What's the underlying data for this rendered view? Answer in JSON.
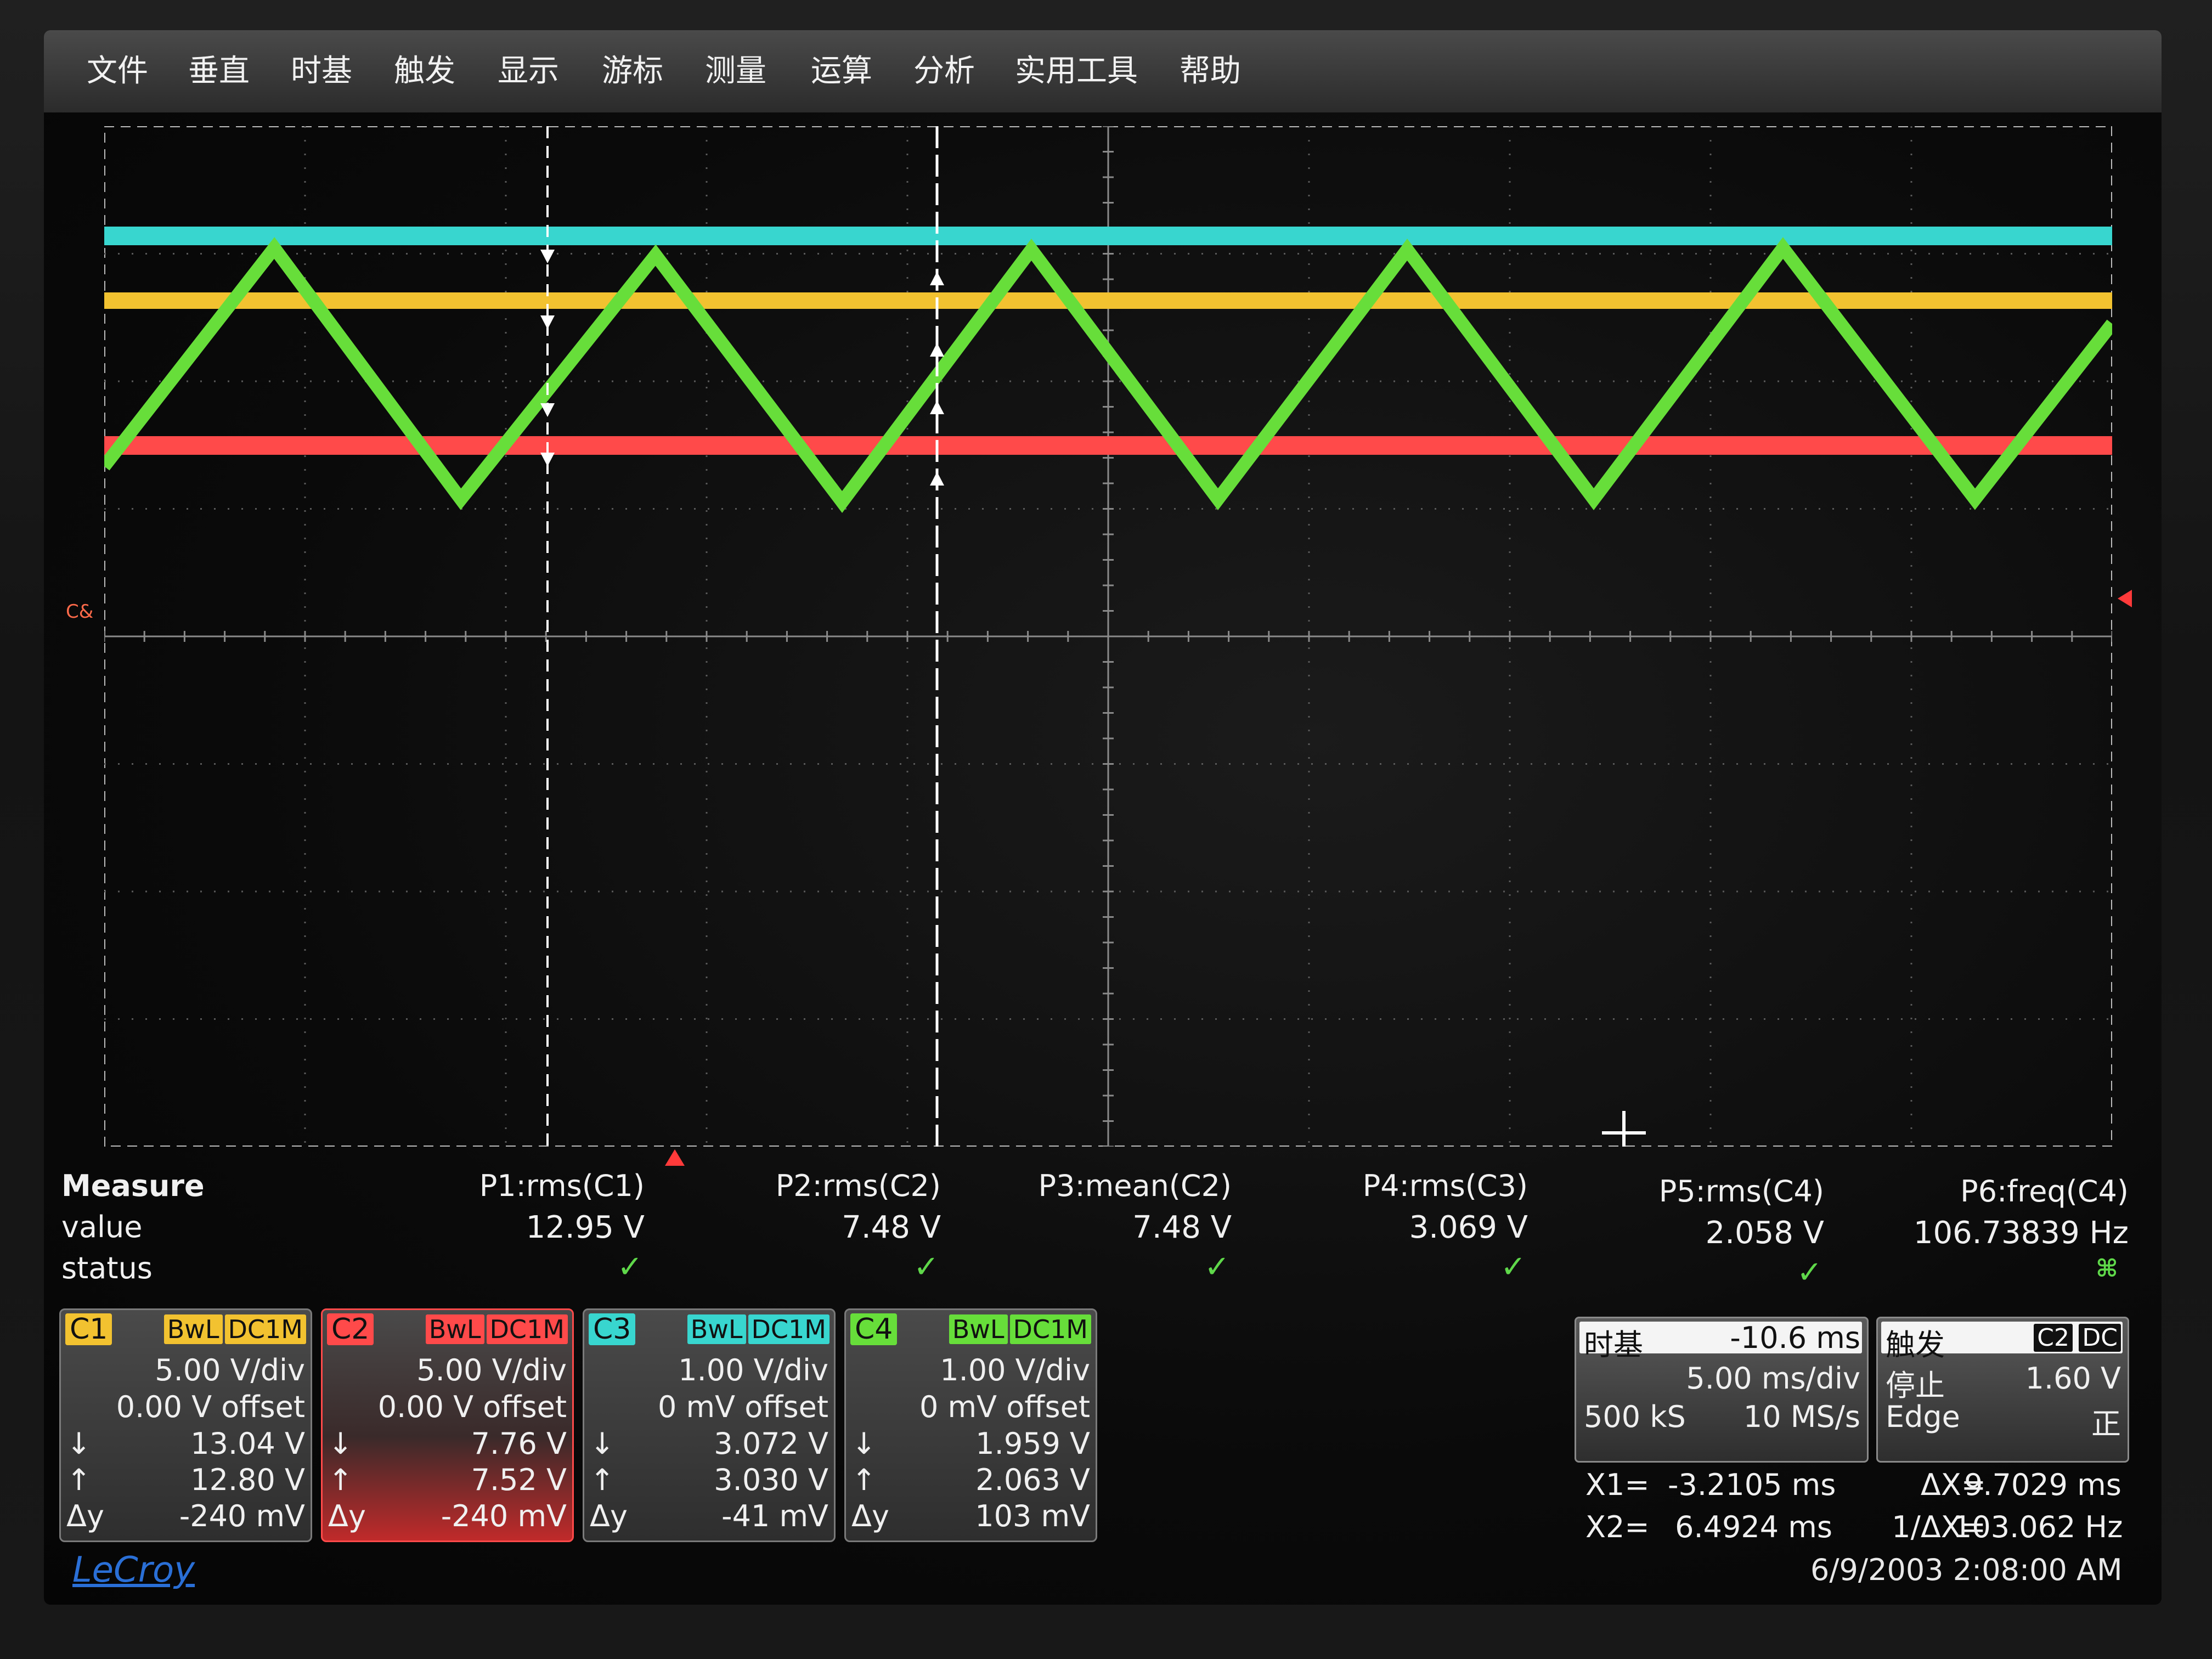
{
  "menu": [
    "文件",
    "垂直",
    "时基",
    "触发",
    "显示",
    "游标",
    "测量",
    "运算",
    "分析",
    "实用工具",
    "帮助"
  ],
  "ground_marker_label": "C&",
  "measure": {
    "row_labels": {
      "measure": "Measure",
      "value": "value",
      "status": "status"
    },
    "params": [
      {
        "name": "P1:rms(C1)",
        "value": "12.95 V",
        "ok": true
      },
      {
        "name": "P2:rms(C2)",
        "value": "7.48 V",
        "ok": true
      },
      {
        "name": "P3:mean(C2)",
        "value": "7.48 V",
        "ok": true
      },
      {
        "name": "P4:rms(C3)",
        "value": "3.069 V",
        "ok": true
      },
      {
        "name": "P5:rms(C4)",
        "value": "2.058 V",
        "ok": true
      },
      {
        "name": "P6:freq(C4)",
        "value": "106.73839 Hz",
        "ok": false
      }
    ],
    "check_glyph": "✓",
    "warn_glyph": "⌘"
  },
  "channels": [
    {
      "id": "C1",
      "color": "#f2c230",
      "bw": "BwL",
      "cpl": "DC1M",
      "vdiv": "5.00 V/div",
      "offset": "0.00 V offset",
      "down": "13.04 V",
      "up": "12.80 V",
      "dy": "-240 mV",
      "selected": false
    },
    {
      "id": "C2",
      "color": "#ff4a4a",
      "bw": "BwL",
      "cpl": "DC1M",
      "vdiv": "5.00 V/div",
      "offset": "0.00 V offset",
      "down": "7.76 V",
      "up": "7.52 V",
      "dy": "-240 mV",
      "selected": true
    },
    {
      "id": "C3",
      "color": "#38d6cf",
      "bw": "BwL",
      "cpl": "DC1M",
      "vdiv": "1.00 V/div",
      "offset": "0 mV offset",
      "down": "3.072 V",
      "up": "3.030 V",
      "dy": "-41 mV",
      "selected": false
    },
    {
      "id": "C4",
      "color": "#67de3a",
      "bw": "BwL",
      "cpl": "DC1M",
      "vdiv": "1.00 V/div",
      "offset": "0 mV offset",
      "down": "1.959 V",
      "up": "2.063 V",
      "dy": "103 mV",
      "selected": false
    }
  ],
  "symbols": {
    "down": "↓",
    "up": "↑",
    "dy": "Δy"
  },
  "timebase": {
    "label": "时基",
    "delay": "-10.6 ms",
    "tdiv": "5.00 ms/div",
    "samples": "500 kS",
    "rate": "10 MS/s"
  },
  "trigger": {
    "label": "触发",
    "source": "C2",
    "coupling": "DC",
    "mode": "停止",
    "level": "1.60 V",
    "type": "Edge",
    "slope": "正"
  },
  "cursors": {
    "x1_label": "X1=",
    "x1": "-3.2105 ms",
    "x2_label": "X2=",
    "x2": "6.4924 ms",
    "dx_label": "ΔX=",
    "dx": "9.7029 ms",
    "inv_label": "1/ΔX=",
    "inv": "103.062 Hz"
  },
  "brand": "LeCroy",
  "datetime": "6/9/2003 2:08:00 AM",
  "colors": {
    "c1": "#f2c230",
    "c2": "#ff4a4a",
    "c3": "#38d6cf",
    "c4": "#67de3a"
  }
}
